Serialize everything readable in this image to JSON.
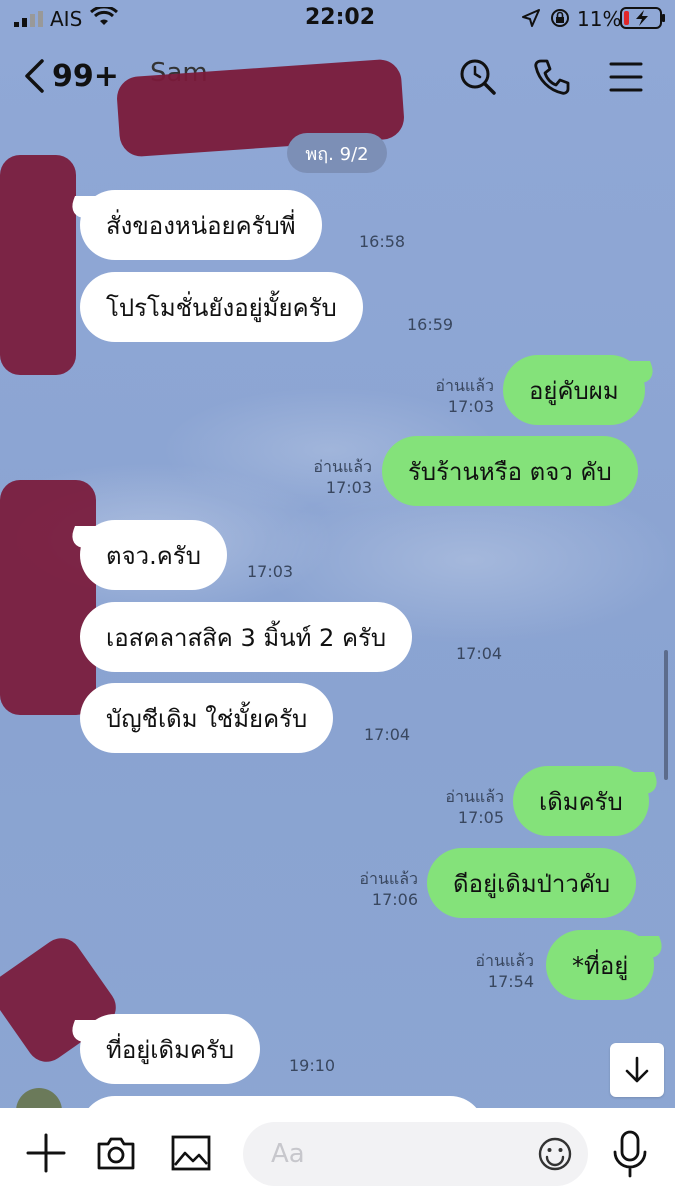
{
  "status_bar": {
    "carrier": "AIS",
    "time": "22:02",
    "battery": "11%"
  },
  "nav": {
    "unread_count": "99+",
    "contact_name": "Sam"
  },
  "chat": {
    "date": "พฤ. 9/2",
    "messages": [
      {
        "dir": "in",
        "text": "สั่งของหน่อยครับพี่",
        "time": "16:58"
      },
      {
        "dir": "in",
        "text": "โปรโมชั่นยังอยู่มั้ยครับ",
        "time": "16:59"
      },
      {
        "dir": "out",
        "text": "อยู่คับผม",
        "read": "อ่านแล้ว",
        "time": "17:03"
      },
      {
        "dir": "out",
        "text": "รับร้านหรือ ตจว คับ",
        "read": "อ่านแล้ว",
        "time": "17:03"
      },
      {
        "dir": "in",
        "text": "ตจว.ครับ",
        "time": "17:03"
      },
      {
        "dir": "in",
        "text": "เอสคลาสสิค 3 มิ้นท์ 2 ครับ",
        "time": "17:04"
      },
      {
        "dir": "in",
        "text": "บัญชีเดิม ใช่มั้ยครับ",
        "time": "17:04"
      },
      {
        "dir": "out",
        "text": "เดิมครับ",
        "read": "อ่านแล้ว",
        "time": "17:05"
      },
      {
        "dir": "out",
        "text": "ดีอยู่เดิมป่าวคับ",
        "read": "อ่านแล้ว",
        "time": "17:06"
      },
      {
        "dir": "out",
        "text": "*ที่อยู่",
        "read": "อ่านแล้ว",
        "time": "17:54"
      },
      {
        "dir": "in",
        "text": "ที่อยู่เดิมครับ",
        "time": "19:10"
      }
    ]
  },
  "input": {
    "placeholder": "Aa"
  },
  "icons": {
    "back": "chevron-left-icon",
    "search": "search-icon",
    "call": "phone-icon",
    "menu": "menu-icon",
    "plus": "plus-icon",
    "camera": "camera-icon",
    "image": "image-icon",
    "emoji": "emoji-icon",
    "mic": "mic-icon",
    "scroll": "arrow-down-icon"
  },
  "colors": {
    "outgoing_bubble": "#84e27a",
    "incoming_bubble": "#ffffff",
    "background": "#8fa8d4"
  }
}
